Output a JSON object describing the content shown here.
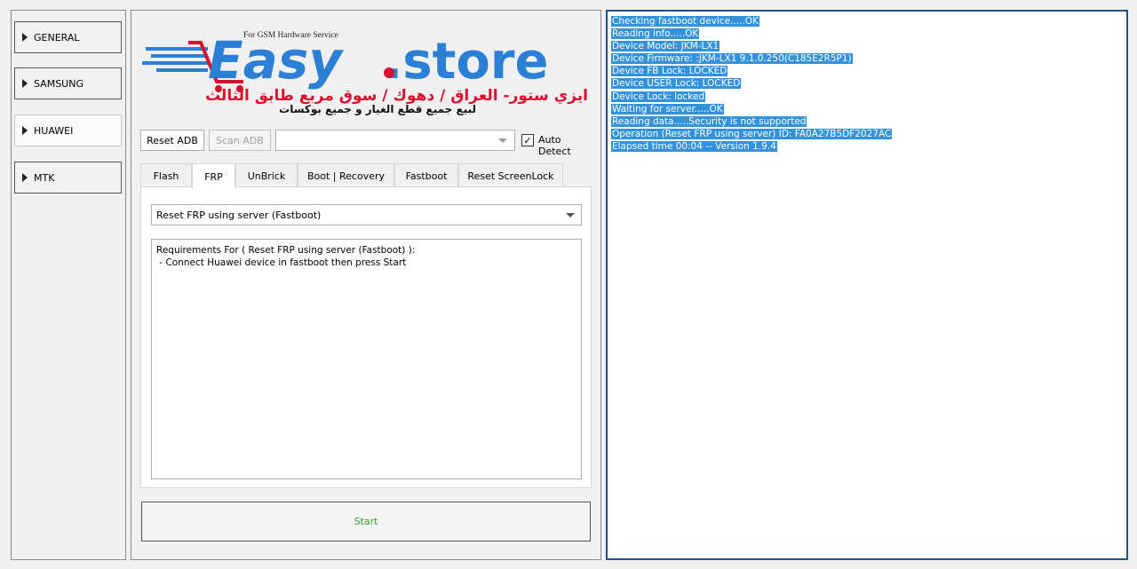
{
  "sidebar": {
    "items": [
      {
        "label": "GENERAL"
      },
      {
        "label": "SAMSUNG"
      },
      {
        "label": "HUAWEI"
      },
      {
        "label": "MTK"
      }
    ]
  },
  "logo": {
    "tagline": "For GSM Hardware Service",
    "brand_left": "Easy",
    "brand_right": ".store",
    "arabic_line1": "ايزي ستور- العراق / دهوك / سوق مربع طابق الثالث",
    "arabic_line2": "لبيع جميع قطع الغيار و جميع بوكسات"
  },
  "toolbar": {
    "reset_adb": "Reset ADB",
    "scan_adb": "Scan ADB",
    "device_combo_value": "",
    "auto_detect_label": "Auto Detect",
    "auto_detect_checked": "✓"
  },
  "tabs": [
    {
      "label": "Flash"
    },
    {
      "label": "FRP"
    },
    {
      "label": "UnBrick"
    },
    {
      "label": "Boot | Recovery"
    },
    {
      "label": "Fastboot"
    },
    {
      "label": "Reset ScreenLock"
    }
  ],
  "frp": {
    "operation_selected": "Reset FRP using server (Fastboot)",
    "requirements": "Requirements For ( Reset FRP using server (Fastboot) ):\n - Connect Huawei device in fastboot then press Start"
  },
  "start_label": "Start",
  "log": [
    "Checking fastboot device.....OK",
    "Reading info.....OK",
    "Device Model: JKM-LX1",
    "Device Firmware: :JKM-LX1 9.1.0.250(C185E2R5P1)",
    "Device FB Lock: LOCKED",
    "Device USER Lock: LOCKED",
    "Device Lock: locked",
    "Waiting for server.....OK",
    "Reading data.....Security is not supported",
    "Operation (Reset FRP using server) ID: FA0A27B5DF2027AC",
    "Elapsed time 00:04 -- Version 1.9.4"
  ],
  "colors": {
    "brand_blue": "#2b7fd4",
    "brand_red": "#d8102d",
    "start_green": "#2e9d2e",
    "log_highlight": "#3292db"
  }
}
